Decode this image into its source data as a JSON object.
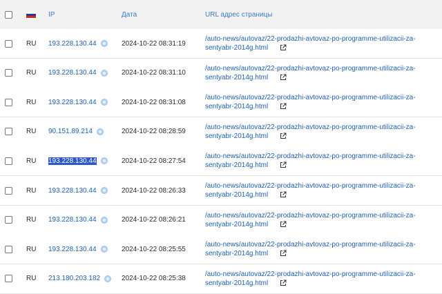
{
  "header": {
    "ip": "IP",
    "date": "Дата",
    "url": "URL адрес страницы"
  },
  "rows": [
    {
      "country": "RU",
      "ip": "193.228.130.44",
      "date": "2024-10-22 08:31:19",
      "url1": "/auto-news/autovaz/22-prodazhi-avtovaz-po-programme-utilizacii-za-",
      "url2": "sentyabr-2014g.html"
    },
    {
      "country": "RU",
      "ip": "193.228.130.44",
      "date": "2024-10-22 08:31:10",
      "url1": "/auto-news/autovaz/22-prodazhi-avtovaz-po-programme-utilizacii-za-",
      "url2": "sentyabr-2014g.html"
    },
    {
      "country": "RU",
      "ip": "193.228.130.44",
      "date": "2024-10-22 08:31:08",
      "url1": "/auto-news/autovaz/22-prodazhi-avtovaz-po-programme-utilizacii-za-",
      "url2": "sentyabr-2014g.html"
    },
    {
      "country": "RU",
      "ip": "90.151.89.214",
      "date": "2024-10-22 08:28:59",
      "url1": "/auto-news/autovaz/22-prodazhi-avtovaz-po-programme-utilizacii-za-",
      "url2": "sentyabr-2014g.html"
    },
    {
      "country": "RU",
      "ip": "193.228.130.44",
      "date": "2024-10-22 08:27:54",
      "url1": "/auto-news/autovaz/22-prodazhi-avtovaz-po-programme-utilizacii-za-",
      "url2": "sentyabr-2014g.html"
    },
    {
      "country": "RU",
      "ip": "193.228.130.44",
      "date": "2024-10-22 08:26:33",
      "url1": "/auto-news/autovaz/22-prodazhi-avtovaz-po-programme-utilizacii-za-",
      "url2": "sentyabr-2014g.html"
    },
    {
      "country": "RU",
      "ip": "193.228.130.44",
      "date": "2024-10-22 08:26:21",
      "url1": "/auto-news/autovaz/22-prodazhi-avtovaz-po-programme-utilizacii-za-",
      "url2": "sentyabr-2014g.html"
    },
    {
      "country": "RU",
      "ip": "193.228.130.44",
      "date": "2024-10-22 08:25:55",
      "url1": "/auto-news/autovaz/22-prodazhi-avtovaz-po-programme-utilizacii-za-",
      "url2": "sentyabr-2014g.html"
    },
    {
      "country": "RU",
      "ip": "213.180.203.182",
      "date": "2024-10-22 08:25:38",
      "url1": "/auto-news/autovaz/22-prodazhi-avtovaz-po-programme-utilizacii-za-",
      "url2": "sentyabr-2014g.html"
    }
  ],
  "selected_row_index": 4,
  "icons": {
    "flag": "russia-flag-icon",
    "ip_action": "ip-info-icon",
    "url_action": "external-link-icon"
  },
  "colors": {
    "link": "#1f5fb0",
    "header_label": "#3d7ac4",
    "selection": "#2b57c8",
    "header_bg": "#f2f2f2"
  }
}
